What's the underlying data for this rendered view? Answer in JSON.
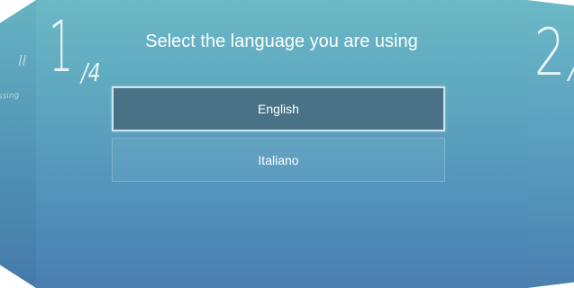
{
  "wizard": {
    "current_step": "1",
    "total_step_label": "/4",
    "title": "Select the language you are using"
  },
  "languages": [
    {
      "label": "English",
      "selected": true
    },
    {
      "label": "Italiano",
      "selected": false
    }
  ],
  "next_panel": {
    "step_number": "2",
    "step_slash": "/"
  },
  "prev_panel": {
    "fragment_top": "ll",
    "fragment_bottom": "ssing"
  },
  "colors": {
    "panel_top": "#6bb9c6",
    "panel_bottom": "#4a7fb0",
    "selected_option": "#4a7286",
    "text": "#ffffff"
  }
}
